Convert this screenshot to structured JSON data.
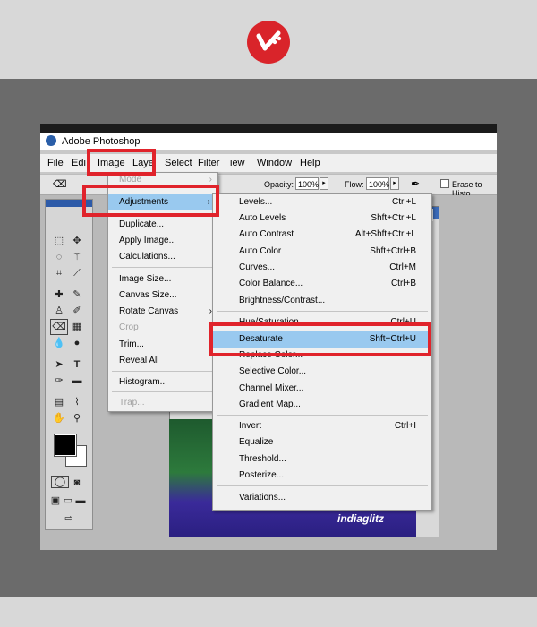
{
  "brand": {
    "logo": "brand-logo-icon"
  },
  "app": {
    "title": "Adobe Photoshop"
  },
  "menubar": {
    "items": [
      "File",
      "Edi",
      "Image",
      "Laye",
      "Select",
      "Filter",
      "iew",
      "Window",
      "Help"
    ]
  },
  "options": {
    "opacity_label": "Opacity:",
    "opacity_value": "100%",
    "flow_label": "Flow:",
    "flow_value": "100%",
    "erase_label": "Erase to Histo"
  },
  "image_menu": {
    "items": [
      {
        "label": "Mode",
        "arrow": "›"
      },
      {
        "label": "Adjustments",
        "arrow": "›"
      },
      {
        "label": "Duplicate..."
      },
      {
        "label": "Apply Image..."
      },
      {
        "label": "Calculations..."
      },
      {
        "label": "Image Size..."
      },
      {
        "label": "Canvas Size..."
      },
      {
        "label": "Rotate Canvas",
        "arrow": "›"
      },
      {
        "label": "Crop"
      },
      {
        "label": "Trim..."
      },
      {
        "label": "Reveal All"
      },
      {
        "label": "Histogram..."
      },
      {
        "label": "Trap..."
      }
    ]
  },
  "adjust_menu": {
    "items": [
      {
        "label": "Levels...",
        "shortcut": "Ctrl+L"
      },
      {
        "label": "Auto Levels",
        "shortcut": "Shft+Ctrl+L"
      },
      {
        "label": "Auto Contrast",
        "shortcut": "Alt+Shft+Ctrl+L"
      },
      {
        "label": "Auto Color",
        "shortcut": "Shft+Ctrl+B"
      },
      {
        "label": "Curves...",
        "shortcut": "Ctrl+M"
      },
      {
        "label": "Color Balance...",
        "shortcut": "Ctrl+B"
      },
      {
        "label": "Brightness/Contrast...",
        "shortcut": ""
      },
      {
        "label": "Hue/Saturation...",
        "shortcut": "Ctrl+U"
      },
      {
        "label": "Desaturate",
        "shortcut": "Shft+Ctrl+U"
      },
      {
        "label": "Replace Color...",
        "shortcut": ""
      },
      {
        "label": "Selective Color...",
        "shortcut": ""
      },
      {
        "label": "Channel Mixer...",
        "shortcut": ""
      },
      {
        "label": "Gradient Map...",
        "shortcut": ""
      },
      {
        "label": "Invert",
        "shortcut": "Ctrl+I"
      },
      {
        "label": "Equalize",
        "shortcut": ""
      },
      {
        "label": "Threshold...",
        "shortcut": ""
      },
      {
        "label": "Posterize...",
        "shortcut": ""
      },
      {
        "label": "Variations...",
        "shortcut": ""
      }
    ]
  },
  "canvas": {
    "watermark": "indiaglitz"
  },
  "colors": {
    "highlight": "#99c9ef",
    "annotation": "#e0232b",
    "brand": "#d9242a"
  }
}
